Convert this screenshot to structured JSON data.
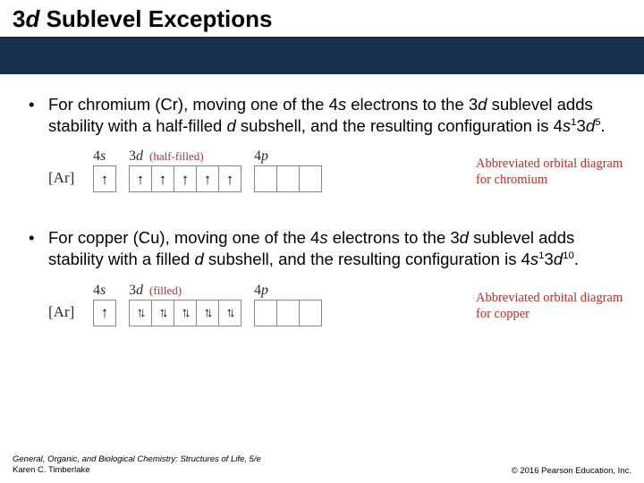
{
  "title": {
    "pre": "3",
    "d": "d",
    "post": " Sublevel Exceptions"
  },
  "bullet1": {
    "p1": "For chromium (Cr), moving one of the 4",
    "s1": "s",
    "p2": " electrons to the 3",
    "d1": "d",
    "p3": " sublevel adds stability with a half-filled ",
    "d2": "d",
    "p4": " subshell, and the resulting configuration is 4",
    "s2": "s",
    "sup1": "1",
    "p5": "3",
    "d3": "d",
    "sup2": "5",
    "p6": "."
  },
  "diagram1": {
    "ar": "[Ar]",
    "lab4s": "4",
    "lab4s_it": "s",
    "lab3d": "3",
    "lab3d_it": "d",
    "note": "(half-filled)",
    "lab4p": "4",
    "lab4p_it": "p",
    "caption1": "Abbreviated orbital diagram",
    "caption2": "for chromium"
  },
  "bullet2": {
    "p1": "For copper (Cu), moving one of the 4",
    "s1": "s",
    "p2": " electrons to the 3",
    "d1": "d",
    "p3": " sublevel adds stability with a filled ",
    "d2": "d",
    "p4": " subshell, and the resulting configuration is 4",
    "s2": "s",
    "sup1": "1",
    "p5": "3",
    "d3": "d",
    "sup2": "10",
    "p6": "."
  },
  "diagram2": {
    "ar": "[Ar]",
    "lab4s": "4",
    "lab4s_it": "s",
    "lab3d": "3",
    "lab3d_it": "d",
    "note": "(filled)",
    "lab4p": "4",
    "lab4p_it": "p",
    "caption1": "Abbreviated orbital diagram",
    "caption2": "for copper"
  },
  "footer": {
    "book": "General, Organic, and Biological Chemistry: Structures of Life, 5/e",
    "author": "Karen C. Timberlake",
    "copyright": "© 2016 Pearson Education, Inc."
  }
}
